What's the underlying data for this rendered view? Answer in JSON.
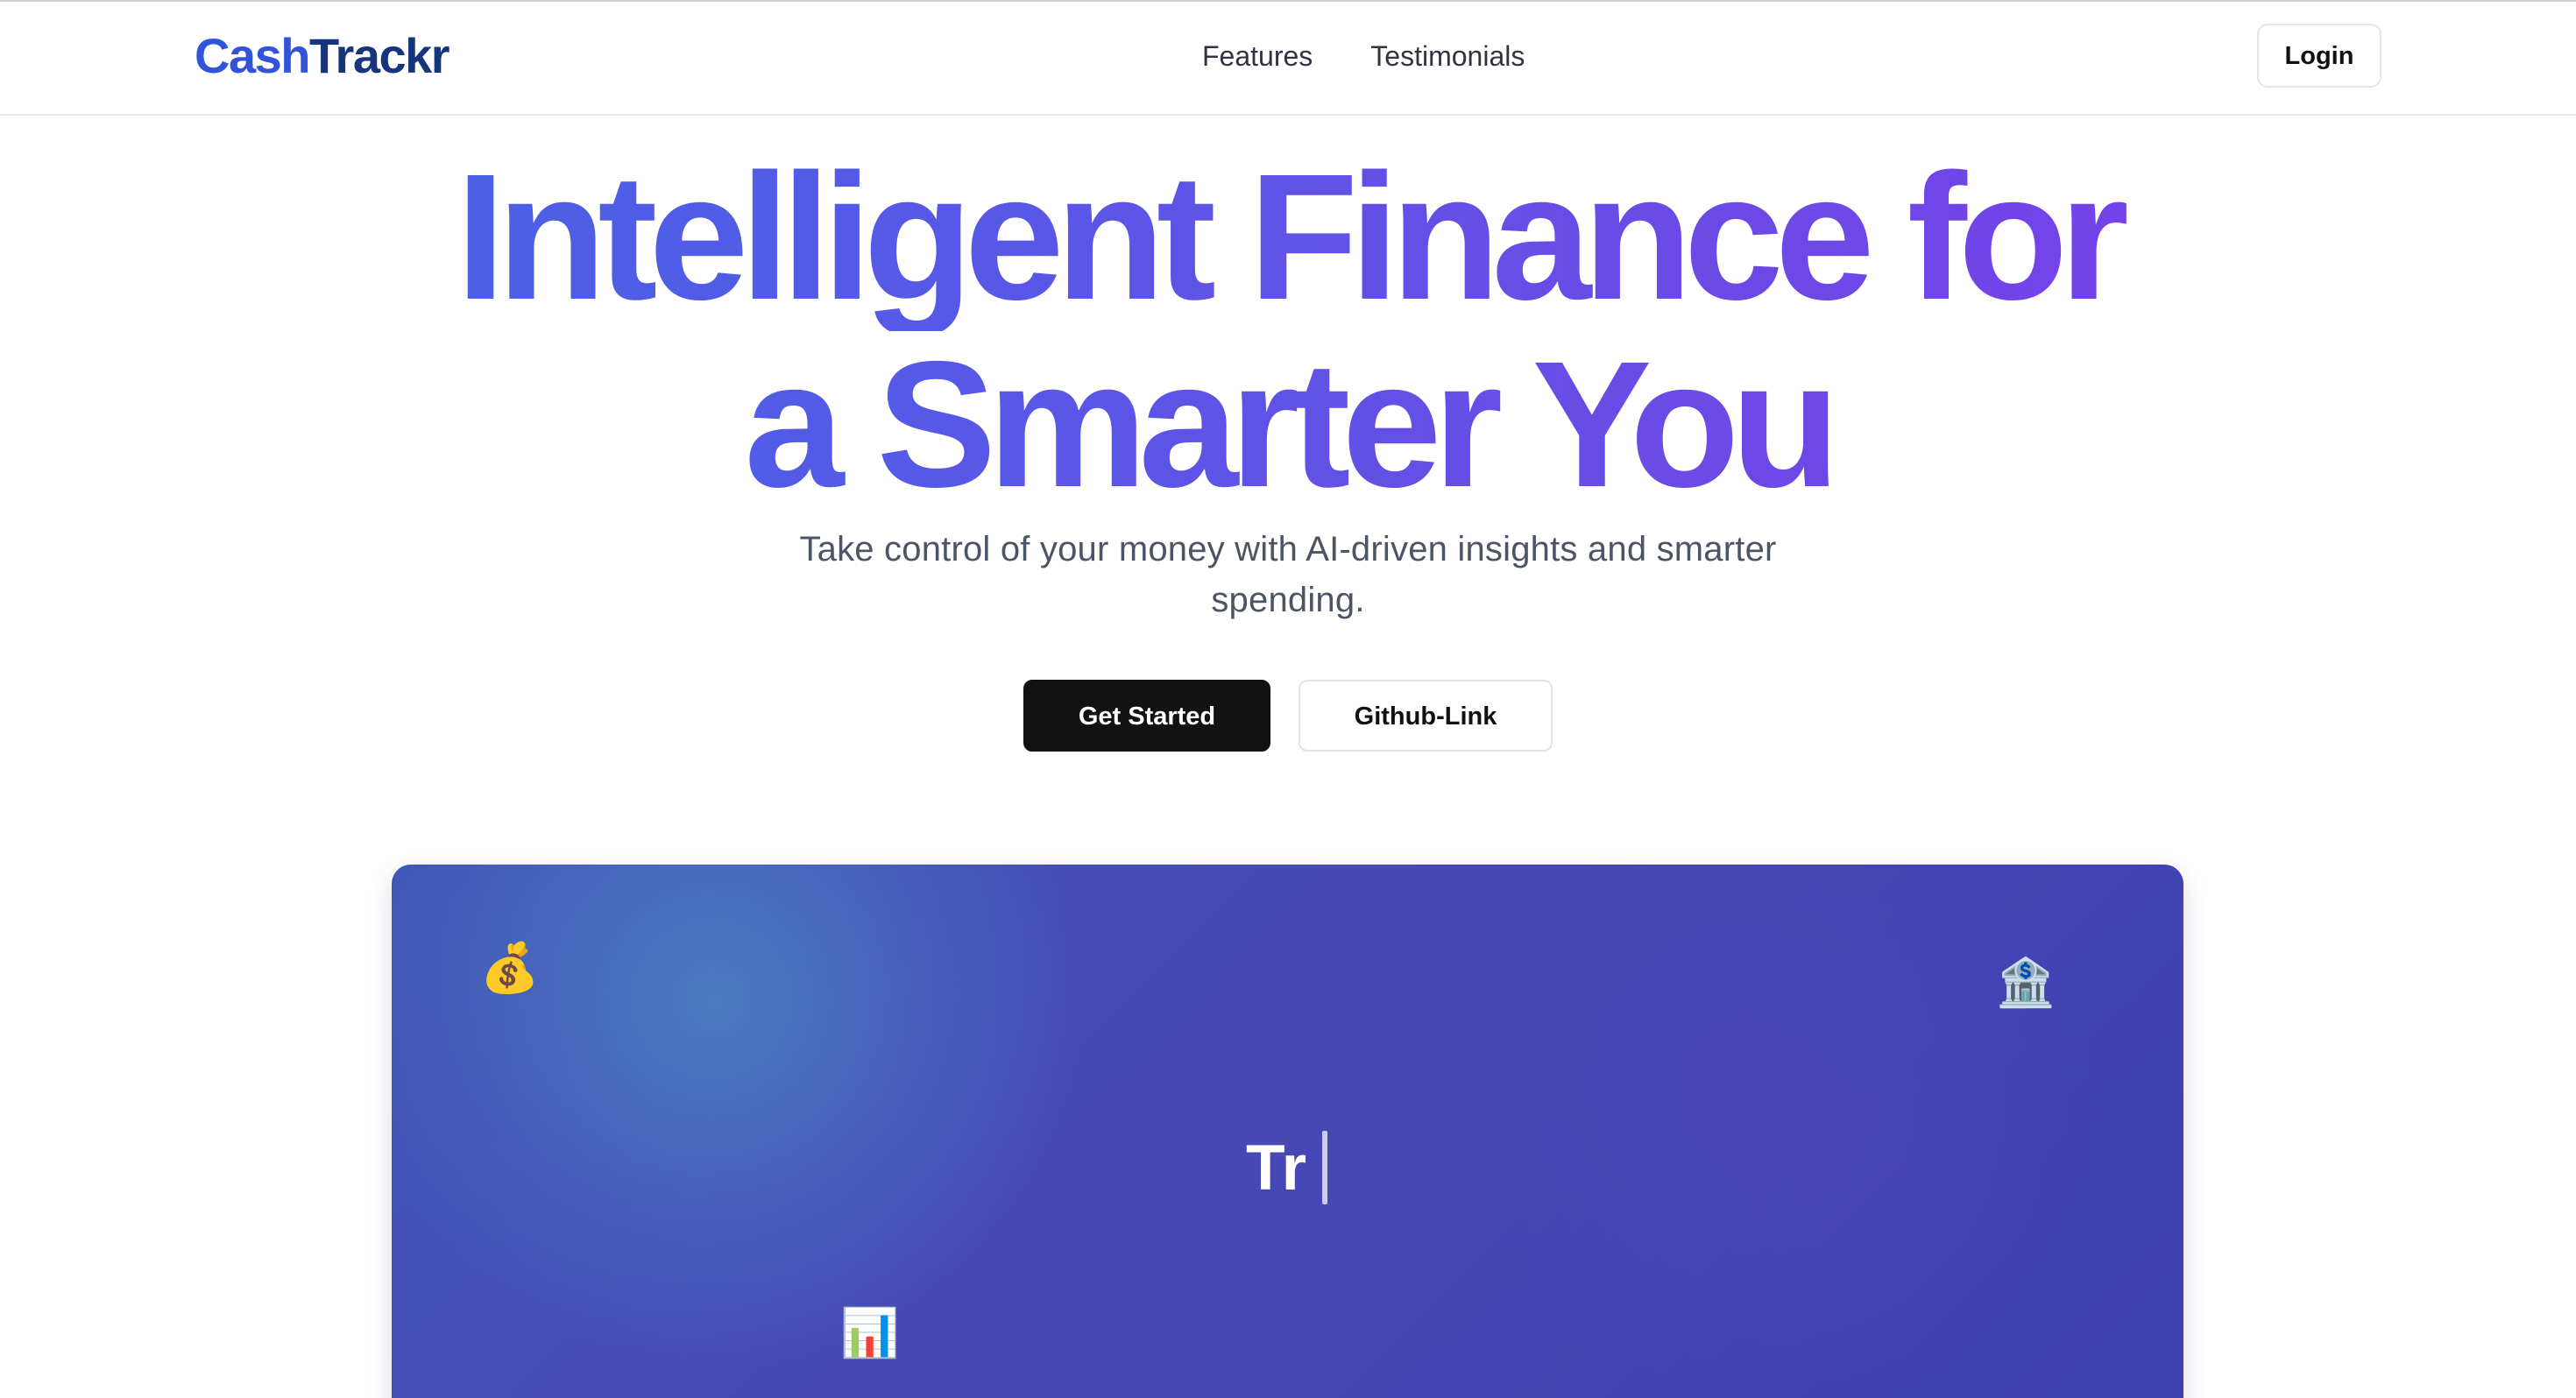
{
  "header": {
    "logo": {
      "part1": "Cash",
      "part2": "Trackr"
    },
    "nav": [
      "Features",
      "Testimonials"
    ],
    "login_label": "Login"
  },
  "hero": {
    "title_line1": "Intelligent Finance for",
    "title_line2": "a Smarter You",
    "subtitle": "Take control of your money with AI-driven insights and smarter spending.",
    "primary_button": "Get Started",
    "secondary_button": "Github-Link"
  },
  "banner": {
    "typing_text": "Tr",
    "icons": {
      "money_bag": "💰",
      "bank": "🏦",
      "chart": "📊"
    }
  },
  "colors": {
    "logo_cash": "#3154d8",
    "logo_trackr": "#17357d",
    "heading_start": "#3f67e2",
    "heading_end": "#7c3aed",
    "banner_background": "#4346b3",
    "primary_button": "#121212"
  }
}
